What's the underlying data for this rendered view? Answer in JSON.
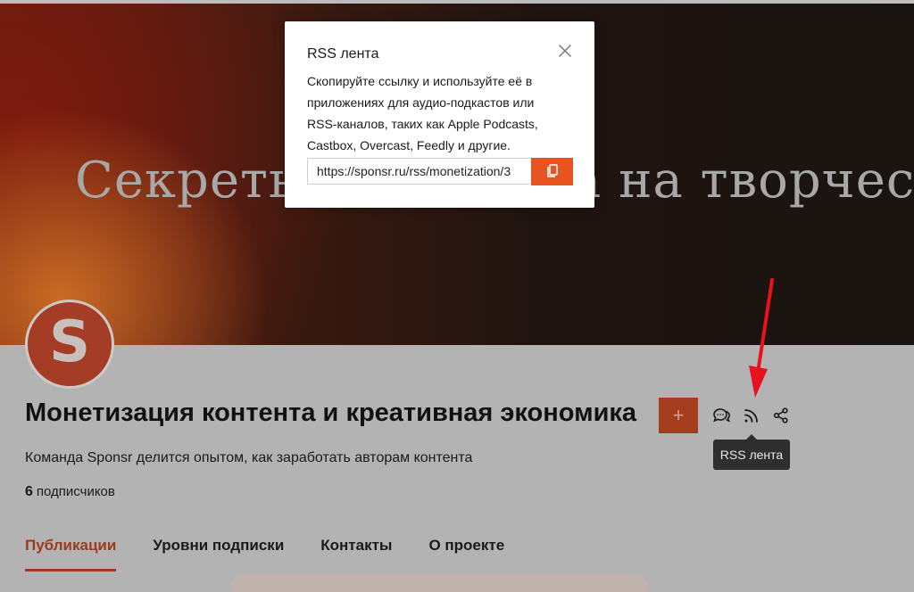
{
  "banner": {
    "title": "Секреты заработка на творчестве"
  },
  "channel": {
    "avatar_letter": "S",
    "title": "Монетизация контента и креативная экономика",
    "description": "Команда Sponsr делится опытом, как заработать авторам контента",
    "subscribers_count": "6",
    "subscribers_label": "подписчиков"
  },
  "actions": {
    "plus_label": "+",
    "chat_icon": "chat-bubbles-icon",
    "rss_icon": "rss-icon",
    "share_icon": "share-icon",
    "tooltip": "RSS лента"
  },
  "tabs": [
    {
      "label": "Публикации",
      "active": true
    },
    {
      "label": "Уровни подписки"
    },
    {
      "label": "Контакты"
    },
    {
      "label": "О проекте"
    }
  ],
  "modal": {
    "title": "RSS лента",
    "text_lines": [
      "Скопируйте ссылку и используйте её в",
      "приложениях для аудио-подкастов или",
      "RSS-каналов, таких как Apple Podcasts,",
      "Castbox, Overcast, Feedly и другие."
    ],
    "url": "https://sponsr.ru/rss/monetization/3",
    "copy_icon": "copy-icon",
    "close_icon": "close-icon"
  },
  "colors": {
    "accent": "#e8531f",
    "accent_dimmed": "#a63d1e",
    "annotation_arrow": "#e8121f"
  }
}
